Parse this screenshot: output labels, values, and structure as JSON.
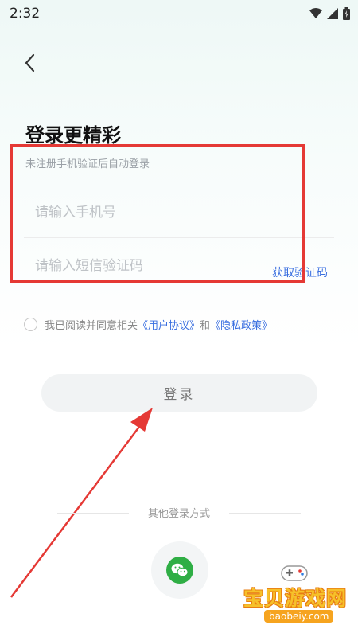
{
  "status_bar": {
    "time": "2:32"
  },
  "page": {
    "title": "登录更精彩",
    "subtitle": "未注册手机验证后自动登录"
  },
  "form": {
    "phone_placeholder": "请输入手机号",
    "code_placeholder": "请输入短信验证码",
    "get_code_label": "获取验证码"
  },
  "agreement": {
    "prefix": "我已阅读并同意相关",
    "user_agreement": "《用户协议》",
    "and": "和",
    "privacy_policy": "《隐私政策》"
  },
  "login_button": "登录",
  "other_login": {
    "label": "其他登录方式"
  },
  "watermark": {
    "title": "宝贝游戏网",
    "url": "baobeiy.com"
  },
  "colors": {
    "accent": "#3a6fe0",
    "annotation": "#e53935",
    "wechat": "#2fae45"
  }
}
